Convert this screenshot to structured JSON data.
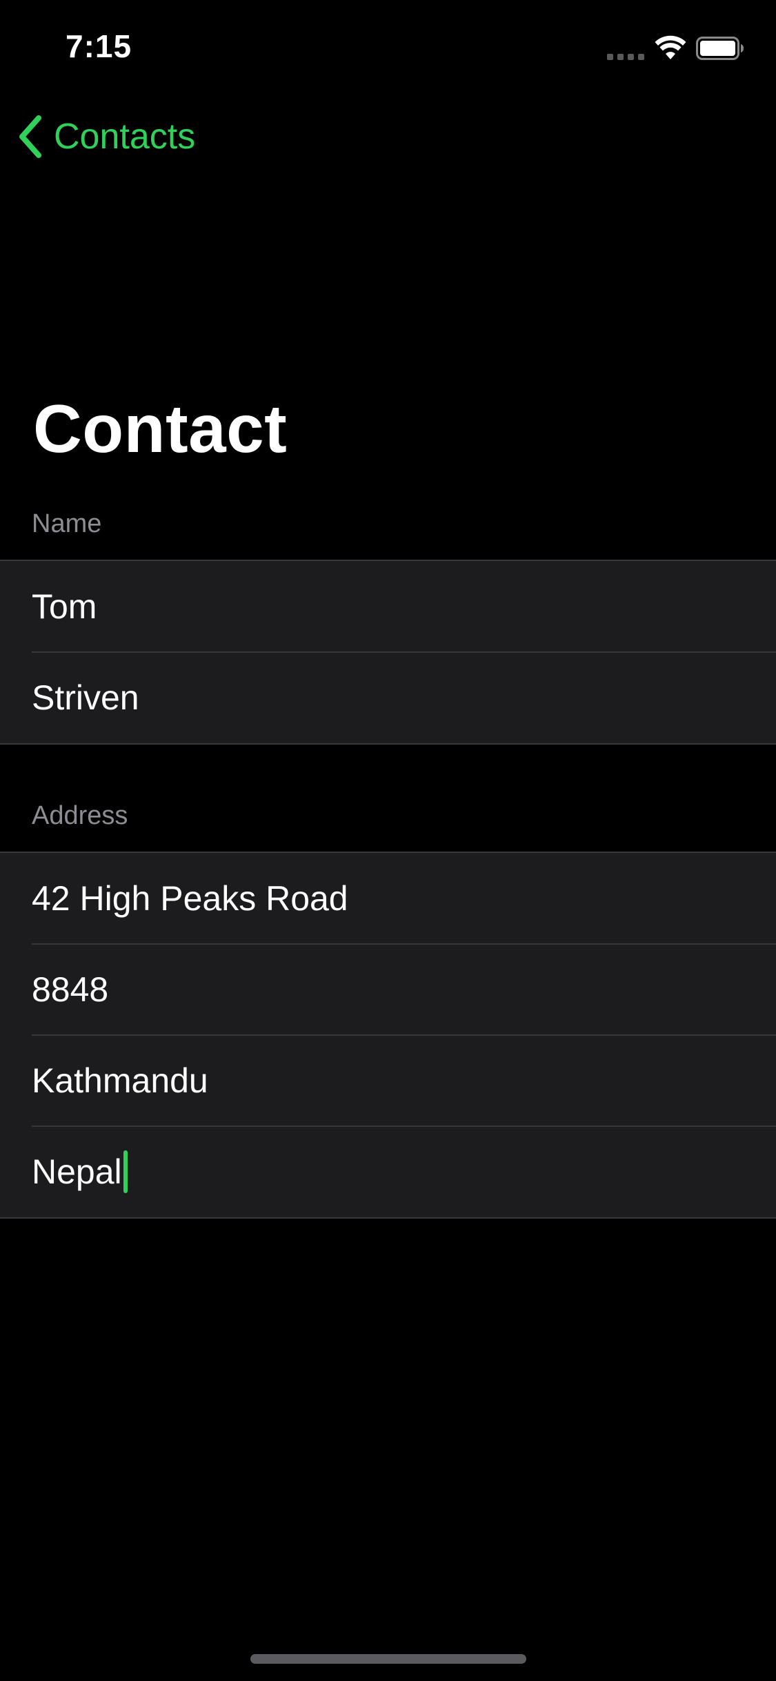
{
  "status_bar": {
    "time": "7:15",
    "icons": [
      "cellular-signal-icon",
      "wifi-icon",
      "battery-icon"
    ]
  },
  "nav": {
    "back_label": "Contacts",
    "back_icon": "chevron-left-icon"
  },
  "page": {
    "title": "Contact"
  },
  "sections": {
    "name": {
      "header": "Name",
      "fields": [
        "Tom",
        "Striven"
      ]
    },
    "address": {
      "header": "Address",
      "fields": [
        "42 High Peaks Road",
        "8848",
        "Kathmandu",
        "Nepal"
      ]
    }
  },
  "colors": {
    "accent": "#30d158",
    "background": "#000000",
    "cell_background": "#1c1c1e",
    "secondary_text": "#8d8d93",
    "separator": "#38383a"
  }
}
